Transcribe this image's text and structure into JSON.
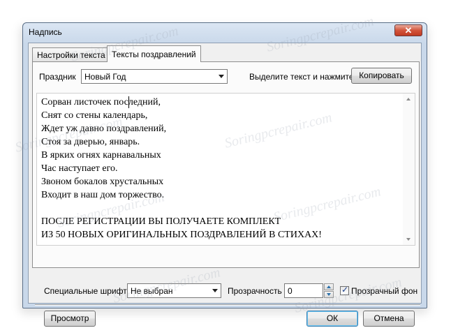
{
  "window": {
    "title": "Надпись",
    "close_glyph": "✕"
  },
  "tabs": [
    {
      "label": "Настройки текста",
      "active": false
    },
    {
      "label": "Тексты поздравлений",
      "active": true
    }
  ],
  "holiday": {
    "label": "Праздник",
    "value": "Новый Год"
  },
  "copy": {
    "hint": "Выделите текст и нажмите",
    "button": "Копировать"
  },
  "editor": {
    "lines": [
      "Сорван листочек последний,",
      "Снят со стены календарь,",
      "Ждет уж давно поздравлений,",
      "Стоя за дверью, январь.",
      "В ярких огнях карнавальных",
      "Час наступает его.",
      "Звоном бокалов хрустальных",
      "Входит в наш дом торжество.",
      "",
      "ПОСЛЕ РЕГИСТРАЦИИ ВЫ ПОЛУЧАЕТЕ КОМПЛЕКТ",
      "ИЗ 50 НОВЫХ ОРИГИНАЛЬНЫХ ПОЗДРАВЛЕНИЙ В СТИХАХ!"
    ]
  },
  "fonts": {
    "label": "Специальные шрифты",
    "value": "Не выбран"
  },
  "transparency": {
    "label": "Прозрачность",
    "value": "0"
  },
  "transparent_bg": {
    "label": "Прозрачный фон",
    "checked": true
  },
  "buttons": {
    "preview": "Просмотр",
    "ok": "ОК",
    "cancel": "Отмена"
  },
  "watermark": "Soringpcrepair.com"
}
